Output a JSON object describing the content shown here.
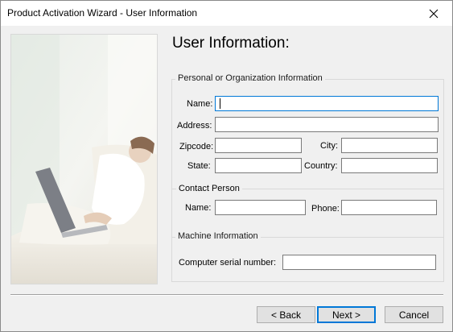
{
  "window": {
    "title": "Product Activation Wizard - User Information",
    "close_icon": "close-icon"
  },
  "page": {
    "heading": "User Information:"
  },
  "personal_group": {
    "legend": "Personal or Organization Information",
    "name_label": "Name:",
    "name_value": "",
    "address_label": "Address:",
    "address_value": "",
    "zipcode_label": "Zipcode:",
    "zipcode_value": "",
    "city_label": "City:",
    "city_value": "",
    "state_label": "State:",
    "state_value": "",
    "country_label": "Country:",
    "country_value": "",
    "contact_subheading": "Contact Person",
    "contact_name_label": "Name:",
    "contact_name_value": "",
    "phone_label": "Phone:",
    "phone_value": ""
  },
  "machine_group": {
    "legend": "Machine Information",
    "serial_label": "Computer serial number:",
    "serial_value": ""
  },
  "buttons": {
    "back": "< Back",
    "next": "Next >",
    "cancel": "Cancel"
  },
  "colors": {
    "focus_accent": "#0078d7",
    "window_bg": "#f0f0f0"
  }
}
